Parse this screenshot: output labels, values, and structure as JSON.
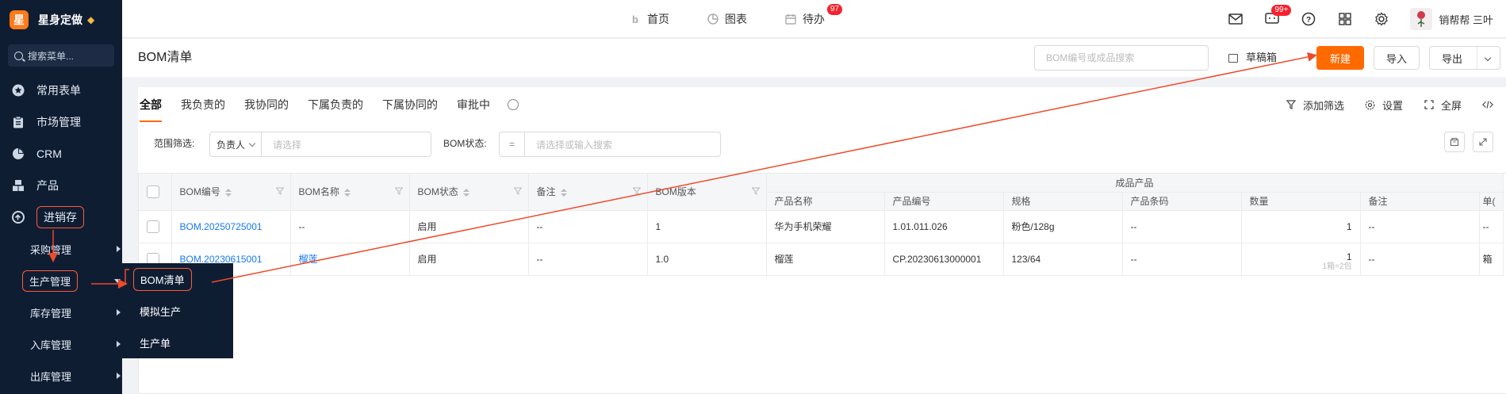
{
  "brand": {
    "logo_char": "星",
    "name": "星身定做"
  },
  "sidebar": {
    "search_placeholder": "搜索菜单...",
    "items": [
      {
        "label": "常用表单",
        "icon": "star-icon"
      },
      {
        "label": "市场管理",
        "icon": "clipboard-icon"
      },
      {
        "label": "CRM",
        "icon": "pie-icon"
      },
      {
        "label": "产品",
        "icon": "boxes-icon"
      },
      {
        "label": "进销存",
        "icon": "inventory-icon"
      }
    ],
    "sub_items": [
      {
        "label": "采购管理"
      },
      {
        "label": "生产管理"
      },
      {
        "label": "库存管理"
      },
      {
        "label": "入库管理"
      },
      {
        "label": "出库管理"
      }
    ],
    "flyout": [
      "BOM清单",
      "模拟生产",
      "生产单"
    ]
  },
  "topnav": {
    "items": [
      {
        "label": "首页",
        "icon": "home-icon"
      },
      {
        "label": "图表",
        "icon": "chart-icon"
      },
      {
        "label": "待办",
        "icon": "calendar-icon",
        "badge": "97"
      }
    ],
    "message_badge": "99+",
    "user": "销帮帮 三叶"
  },
  "titlebar": {
    "title": "BOM清单",
    "search_placeholder": "BOM编号或成品搜索",
    "draft": "草稿箱",
    "new": "新建",
    "import": "导入",
    "export": "导出"
  },
  "tabs": [
    "全部",
    "我负责的",
    "我协同的",
    "下属负责的",
    "下属协同的",
    "审批中"
  ],
  "tools": {
    "filter": "添加筛选",
    "settings": "设置",
    "fullscreen": "全屏"
  },
  "filters": {
    "range_label": "范围筛选:",
    "range_select": "负责人",
    "range_placeholder": "请选择",
    "status_label": "BOM状态:",
    "status_op": "=",
    "status_placeholder": "请选择或输入搜索"
  },
  "table": {
    "group_header": "成品产品",
    "headers": [
      "BOM编号",
      "BOM名称",
      "BOM状态",
      "备注",
      "BOM版本"
    ],
    "sub_headers": [
      "产品名称",
      "产品编号",
      "规格",
      "产品条码",
      "数量",
      "备注",
      "单("
    ],
    "rows": [
      {
        "bom_no": "BOM.20250725001",
        "bom_name": "--",
        "status": "启用",
        "note": "--",
        "version": "1",
        "prod_name": "华为手机荣耀",
        "prod_no": "1.01.011.026",
        "spec": "粉色/128g",
        "barcode": "--",
        "qty": "1",
        "qty_note": "",
        "prod_note": "--",
        "unit": "--"
      },
      {
        "bom_no": "BOM.20230615001",
        "bom_name": "榴莲",
        "status": "启用",
        "note": "--",
        "version": "1.0",
        "prod_name": "榴莲",
        "prod_no": "CP.20230613000001",
        "spec": "123/64",
        "barcode": "--",
        "qty": "1",
        "qty_note": "1箱=2包",
        "prod_note": "--",
        "unit": "箱"
      }
    ]
  },
  "colors": {
    "accent": "#ff6a00",
    "sidebar_bg": "#0f1d33",
    "annotation": "#ee4a2a",
    "link": "#1677ff"
  }
}
